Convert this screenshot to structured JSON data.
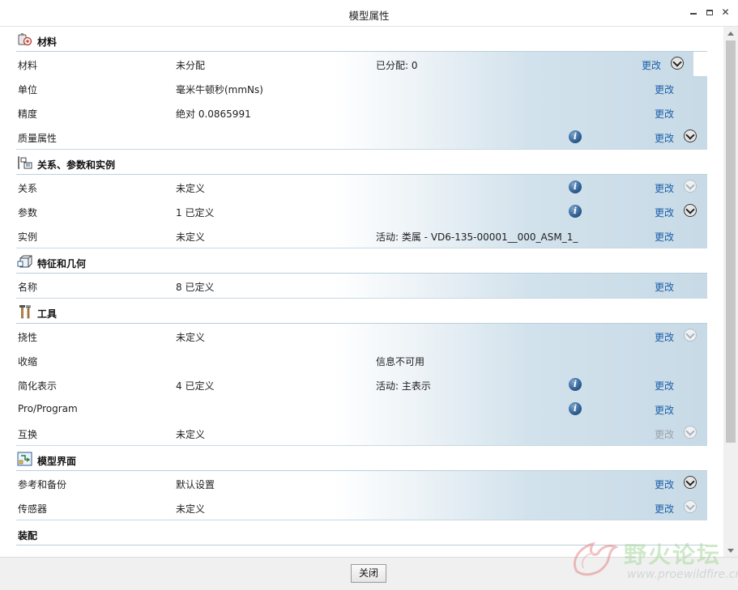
{
  "window": {
    "title": "模型属性"
  },
  "sections": {
    "material": {
      "title": "材料",
      "rows": [
        {
          "label": "材料",
          "value": "未分配",
          "extra": "已分配: 0",
          "change": "更改"
        },
        {
          "label": "单位",
          "value": "毫米牛顿秒(mmNs)",
          "change": "更改"
        },
        {
          "label": "精度",
          "value": "绝对 0.0865991",
          "change": "更改"
        },
        {
          "label": "质量属性",
          "value": "",
          "change": "更改"
        }
      ]
    },
    "relations": {
      "title": "关系、参数和实例",
      "rows": [
        {
          "label": "关系",
          "value": "未定义",
          "change": "更改"
        },
        {
          "label": "参数",
          "value": "1 已定义",
          "change": "更改"
        },
        {
          "label": "实例",
          "value": "未定义",
          "extra": "活动: 类属 - VD6-135-00001__000_ASM_1_",
          "change": "更改"
        }
      ]
    },
    "features": {
      "title": "特征和几何",
      "rows": [
        {
          "label": "名称",
          "value": "8 已定义",
          "change": "更改"
        }
      ]
    },
    "tools": {
      "title": "工具",
      "rows": [
        {
          "label": "挠性",
          "value": "未定义",
          "change": "更改"
        },
        {
          "label": "收缩",
          "value": "",
          "extra": "信息不可用"
        },
        {
          "label": "简化表示",
          "value": "4 已定义",
          "extra": "活动: 主表示",
          "change": "更改"
        },
        {
          "label": "Pro/Program",
          "value": "",
          "change": "更改"
        },
        {
          "label": "互换",
          "value": "未定义",
          "change": "更改"
        }
      ]
    },
    "model_interface": {
      "title": "模型界面",
      "rows": [
        {
          "label": "参考和备份",
          "value": "默认设置",
          "change": "更改"
        },
        {
          "label": "传感器",
          "value": "未定义",
          "change": "更改"
        }
      ]
    },
    "assembly": {
      "title": "装配"
    }
  },
  "footer": {
    "close_label": "关闭"
  },
  "watermark": {
    "text": "野火论坛",
    "url": "www.proewildfire.cn"
  }
}
